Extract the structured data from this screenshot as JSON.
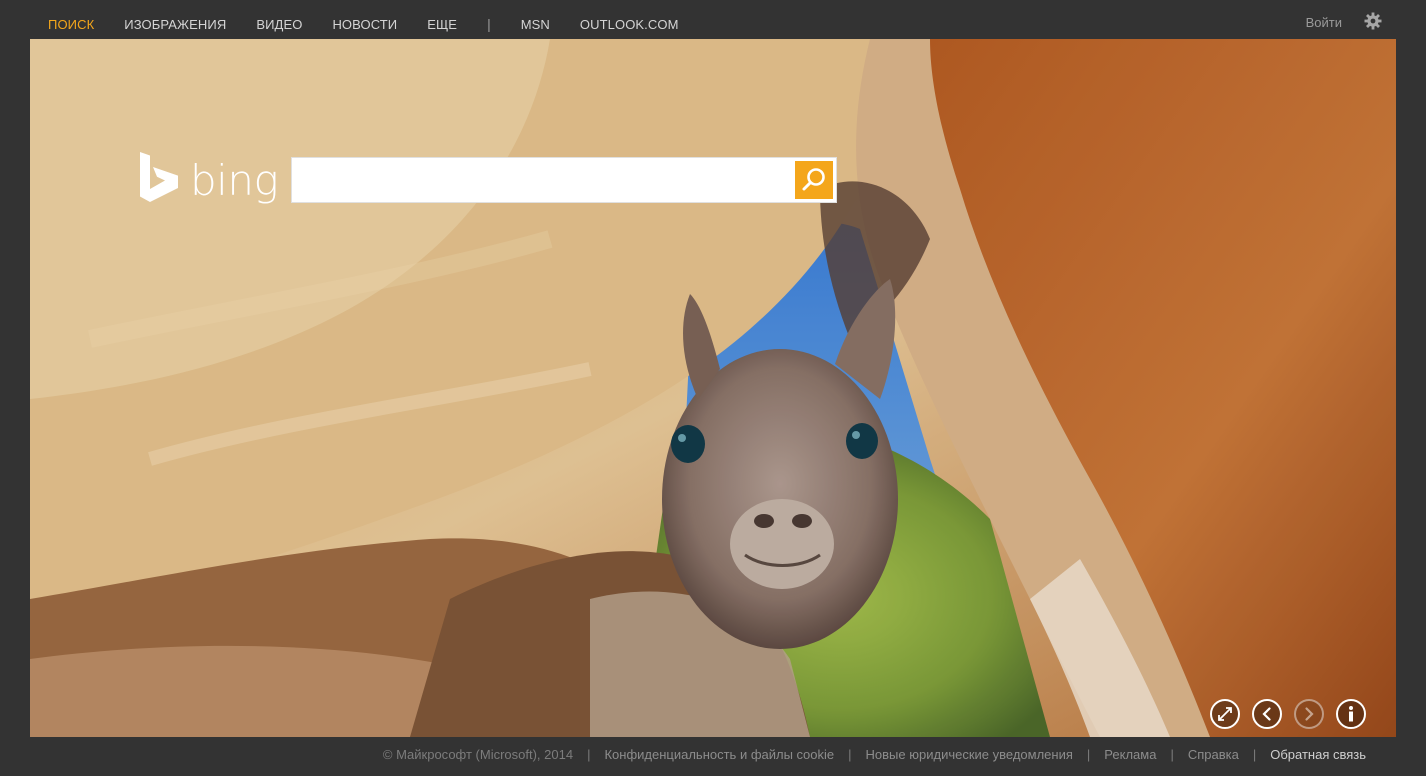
{
  "nav": {
    "items": [
      {
        "label": "ПОИСК",
        "active": true
      },
      {
        "label": "ИЗОБРАЖЕНИЯ"
      },
      {
        "label": "ВИДЕО"
      },
      {
        "label": "НОВОСТИ"
      },
      {
        "label": "ЕЩЕ"
      }
    ],
    "separator": "|",
    "extra": [
      {
        "label": "MSN"
      },
      {
        "label": "OUTLOOK.COM"
      }
    ],
    "signin": "Войти",
    "settings_icon": "gear-icon"
  },
  "logo": {
    "text": "bing",
    "icon": "bing-logo-icon"
  },
  "search": {
    "value": "",
    "placeholder": "",
    "button_icon": "magnifier-icon"
  },
  "controls": {
    "icons": [
      "fullscreen-icon",
      "chevron-left-icon",
      "chevron-right-icon",
      "info-icon"
    ]
  },
  "footer": {
    "copyright": "© Майкрософт (Microsoft), 2014",
    "links": [
      {
        "label": "Конфиденциальность и файлы cookie"
      },
      {
        "label": "Новые юридические уведомления"
      },
      {
        "label": "Реклама"
      },
      {
        "label": "Справка"
      },
      {
        "label": "Обратная связь"
      }
    ]
  },
  "colors": {
    "accent": "#f4a61b",
    "chrome": "#333333",
    "nav_text": "#d4d4d4"
  }
}
